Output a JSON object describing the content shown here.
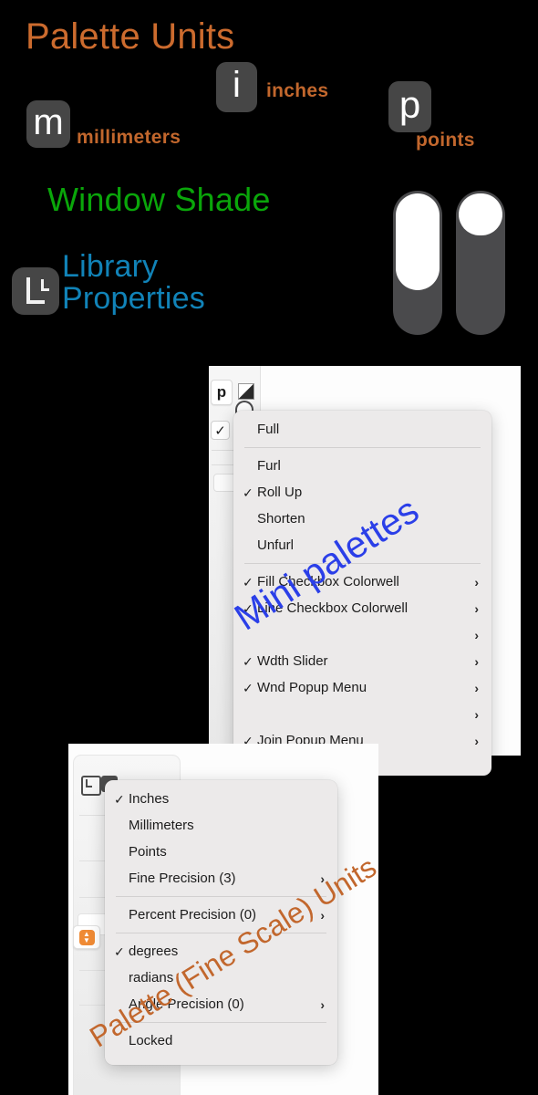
{
  "annotations": {
    "palette_units_title": "Palette Units",
    "window_shade_title": "Window Shade",
    "library_properties_line1": "Library",
    "library_properties_line2": "Properties",
    "inches_label": "inches",
    "millimeters_label": "millimeters",
    "points_label": "points",
    "mini_palettes_callout": "Mini palettes",
    "palette_fine_scale_callout": "Palette (Fine Scale) Units",
    "colors": {
      "orange": "#cc6b2e",
      "green": "#0aa60a",
      "blue_link": "#1183b8",
      "blue_callout": "#2b3fe8",
      "badge_gray": "#464646",
      "accent_stepper": "#ef8a34"
    }
  },
  "badges": {
    "inches_glyph": "i",
    "millimeters_glyph": "m",
    "points_glyph": "p",
    "library_glyph": "L"
  },
  "shade_toggles": [
    {
      "name": "window-shade-toggle-open",
      "fill_percent": 70
    },
    {
      "name": "window-shade-toggle-rolled",
      "fill_percent": 30
    }
  ],
  "mini_palette_panel": {
    "popup_button_label": "p",
    "colorwell_name": "fill-colorwell",
    "checkbox_glyph": "✓",
    "stepper_glyph": "⇅"
  },
  "shade_menu": {
    "items": [
      {
        "label": "Full",
        "checked": false,
        "submenu": false,
        "separator_after": true
      },
      {
        "label": "Furl",
        "checked": false,
        "submenu": false
      },
      {
        "label": "Roll Up",
        "checked": true,
        "submenu": false
      },
      {
        "label": "Shorten",
        "checked": false,
        "submenu": false
      },
      {
        "label": "Unfurl",
        "checked": false,
        "submenu": false,
        "separator_after": true
      },
      {
        "label": "Fill Checkbox Colorwell",
        "checked": true,
        "submenu": true
      },
      {
        "label": "Line Checkbox Colorwell",
        "checked": true,
        "submenu": true
      },
      {
        "label": "",
        "checked": false,
        "submenu": true
      },
      {
        "label": "Wdth Slider",
        "checked": true,
        "submenu": true
      },
      {
        "label": "Wnd Popup Menu",
        "checked": true,
        "submenu": true
      },
      {
        "label": "",
        "checked": false,
        "submenu": true
      },
      {
        "label": "Join Popup Menu",
        "checked": true,
        "submenu": true
      }
    ]
  },
  "units_menu": {
    "items": [
      {
        "label": "Inches",
        "checked": true,
        "submenu": false
      },
      {
        "label": "Millimeters",
        "checked": false,
        "submenu": false
      },
      {
        "label": "Points",
        "checked": false,
        "submenu": false
      },
      {
        "label": "Fine Precision (3)",
        "checked": false,
        "submenu": true,
        "separator_after": true
      },
      {
        "label": "Percent Precision (0)",
        "checked": false,
        "submenu": true,
        "separator_after": true
      },
      {
        "label": "degrees",
        "checked": true,
        "submenu": false
      },
      {
        "label": "radians",
        "checked": false,
        "submenu": false
      },
      {
        "label": "Angle Precision (0)",
        "checked": false,
        "submenu": true,
        "separator_after": true
      },
      {
        "label": "Locked",
        "checked": false,
        "submenu": false
      }
    ]
  },
  "glyphs": {
    "check": "✓",
    "submenu_arrow": "›",
    "stepper_up": "▲",
    "stepper_down": "▼"
  }
}
